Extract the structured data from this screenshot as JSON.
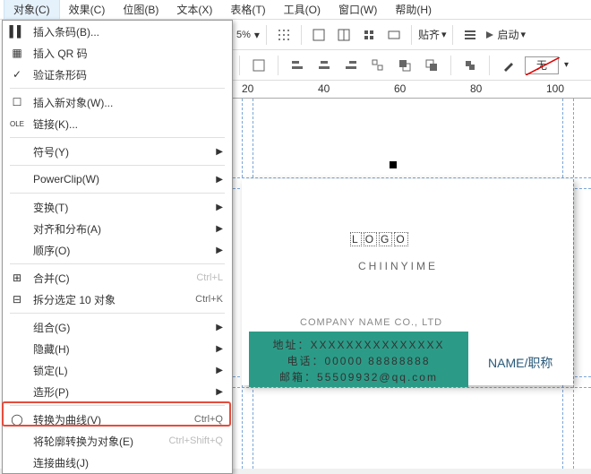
{
  "menubar": [
    "对象(C)",
    "效果(C)",
    "位图(B)",
    "文本(X)",
    "表格(T)",
    "工具(O)",
    "窗口(W)",
    "帮助(H)"
  ],
  "toolbar": {
    "percent": "5%",
    "align": "贴齐",
    "launch": "启动"
  },
  "ruler": {
    "t20": "20",
    "t40": "40",
    "t60": "60",
    "t80": "80",
    "t100": "100"
  },
  "card": {
    "logo": "LOGO",
    "chinese": "CHIINYIME",
    "company": "COMPANY NAME CO., LTD",
    "addr": "地址：XXXXXXXXXXXXXXX",
    "phone": "电话：00000 88888888",
    "email": "邮箱：55509932@qq.com",
    "name": "NAME/职称"
  },
  "menu": {
    "insert_barcode": "插入条码(B)...",
    "insert_qr": "插入 QR 码",
    "validate_barcode": "验证条形码",
    "insert_new_obj": "插入新对象(W)...",
    "links": "链接(K)...",
    "symbols": "符号(Y)",
    "powerclip": "PowerClip(W)",
    "transform": "变换(T)",
    "align": "对齐和分布(A)",
    "order": "顺序(O)",
    "combine": "合并(C)",
    "combine_sc": "Ctrl+L",
    "break": "拆分选定 10 对象",
    "break_sc": "Ctrl+K",
    "group": "组合(G)",
    "hide": "隐藏(H)",
    "lock": "锁定(L)",
    "shaping": "造形(P)",
    "convert_curves": "转换为曲线(V)",
    "convert_sc": "Ctrl+Q",
    "outline_to_obj": "将轮廓转换为对象(E)",
    "outline_sc": "Ctrl+Shift+Q",
    "join_curves": "连接曲线(J)"
  },
  "fill": {
    "none": "无"
  }
}
